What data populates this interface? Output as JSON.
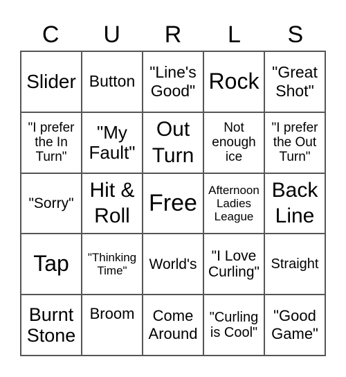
{
  "header": {
    "letters": [
      "C",
      "U",
      "R",
      "L",
      "S"
    ]
  },
  "cells": [
    [
      "Slider",
      "Button",
      "\"Line's Good\"",
      "Rock",
      "\"Great Shot\""
    ],
    [
      "\"I prefer the In Turn\"",
      "\"My Fault\"",
      "Out Turn",
      "Not enough ice",
      "\"I prefer the Out Turn\""
    ],
    [
      "\"Sorry\"",
      "Hit & Roll",
      "Free",
      "Afternoon Ladies League",
      "Back Line"
    ],
    [
      "Tap",
      "\"Thinking Time\"",
      "World's",
      "\"I Love Curling\"",
      "Straight"
    ],
    [
      "Burnt Stone",
      "Broom",
      "Come Around",
      "\"Curling is Cool\"",
      "\"Good Game\""
    ]
  ]
}
